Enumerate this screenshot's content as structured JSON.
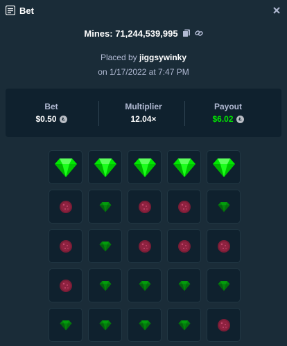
{
  "window": {
    "title": "Bet",
    "close_icon": "close-icon",
    "title_icon": "bet-slip-icon"
  },
  "mines": {
    "label": "Mines: 71,244,539,995",
    "copy_icon": "copy-icon",
    "link_icon": "link-icon"
  },
  "placed": {
    "prefix": "Placed by ",
    "username": "jiggsywinky",
    "date": "on 1/17/2022 at 7:47 PM"
  },
  "summary": {
    "bet": {
      "label": "Bet",
      "value": "$0.50",
      "currency_icon": "litecoin-icon"
    },
    "multiplier": {
      "label": "Multiplier",
      "value": "12.04×"
    },
    "payout": {
      "label": "Payout",
      "value": "$6.02",
      "currency_icon": "litecoin-icon"
    }
  },
  "grid": {
    "rows": [
      [
        "gem-revealed",
        "gem-revealed",
        "gem-revealed",
        "gem-revealed",
        "gem-revealed"
      ],
      [
        "mine",
        "gem",
        "mine",
        "mine",
        "gem"
      ],
      [
        "mine",
        "gem",
        "mine",
        "mine",
        "mine"
      ],
      [
        "mine",
        "gem",
        "gem",
        "gem",
        "gem"
      ],
      [
        "gem",
        "gem",
        "gem",
        "gem",
        "mine"
      ]
    ]
  },
  "colors": {
    "background": "#1a2c38",
    "panel": "#0f212e",
    "accent_green": "#00e701",
    "muted_text": "#b1bad3",
    "gem": "#00e701",
    "mine": "#8b1a3a"
  }
}
